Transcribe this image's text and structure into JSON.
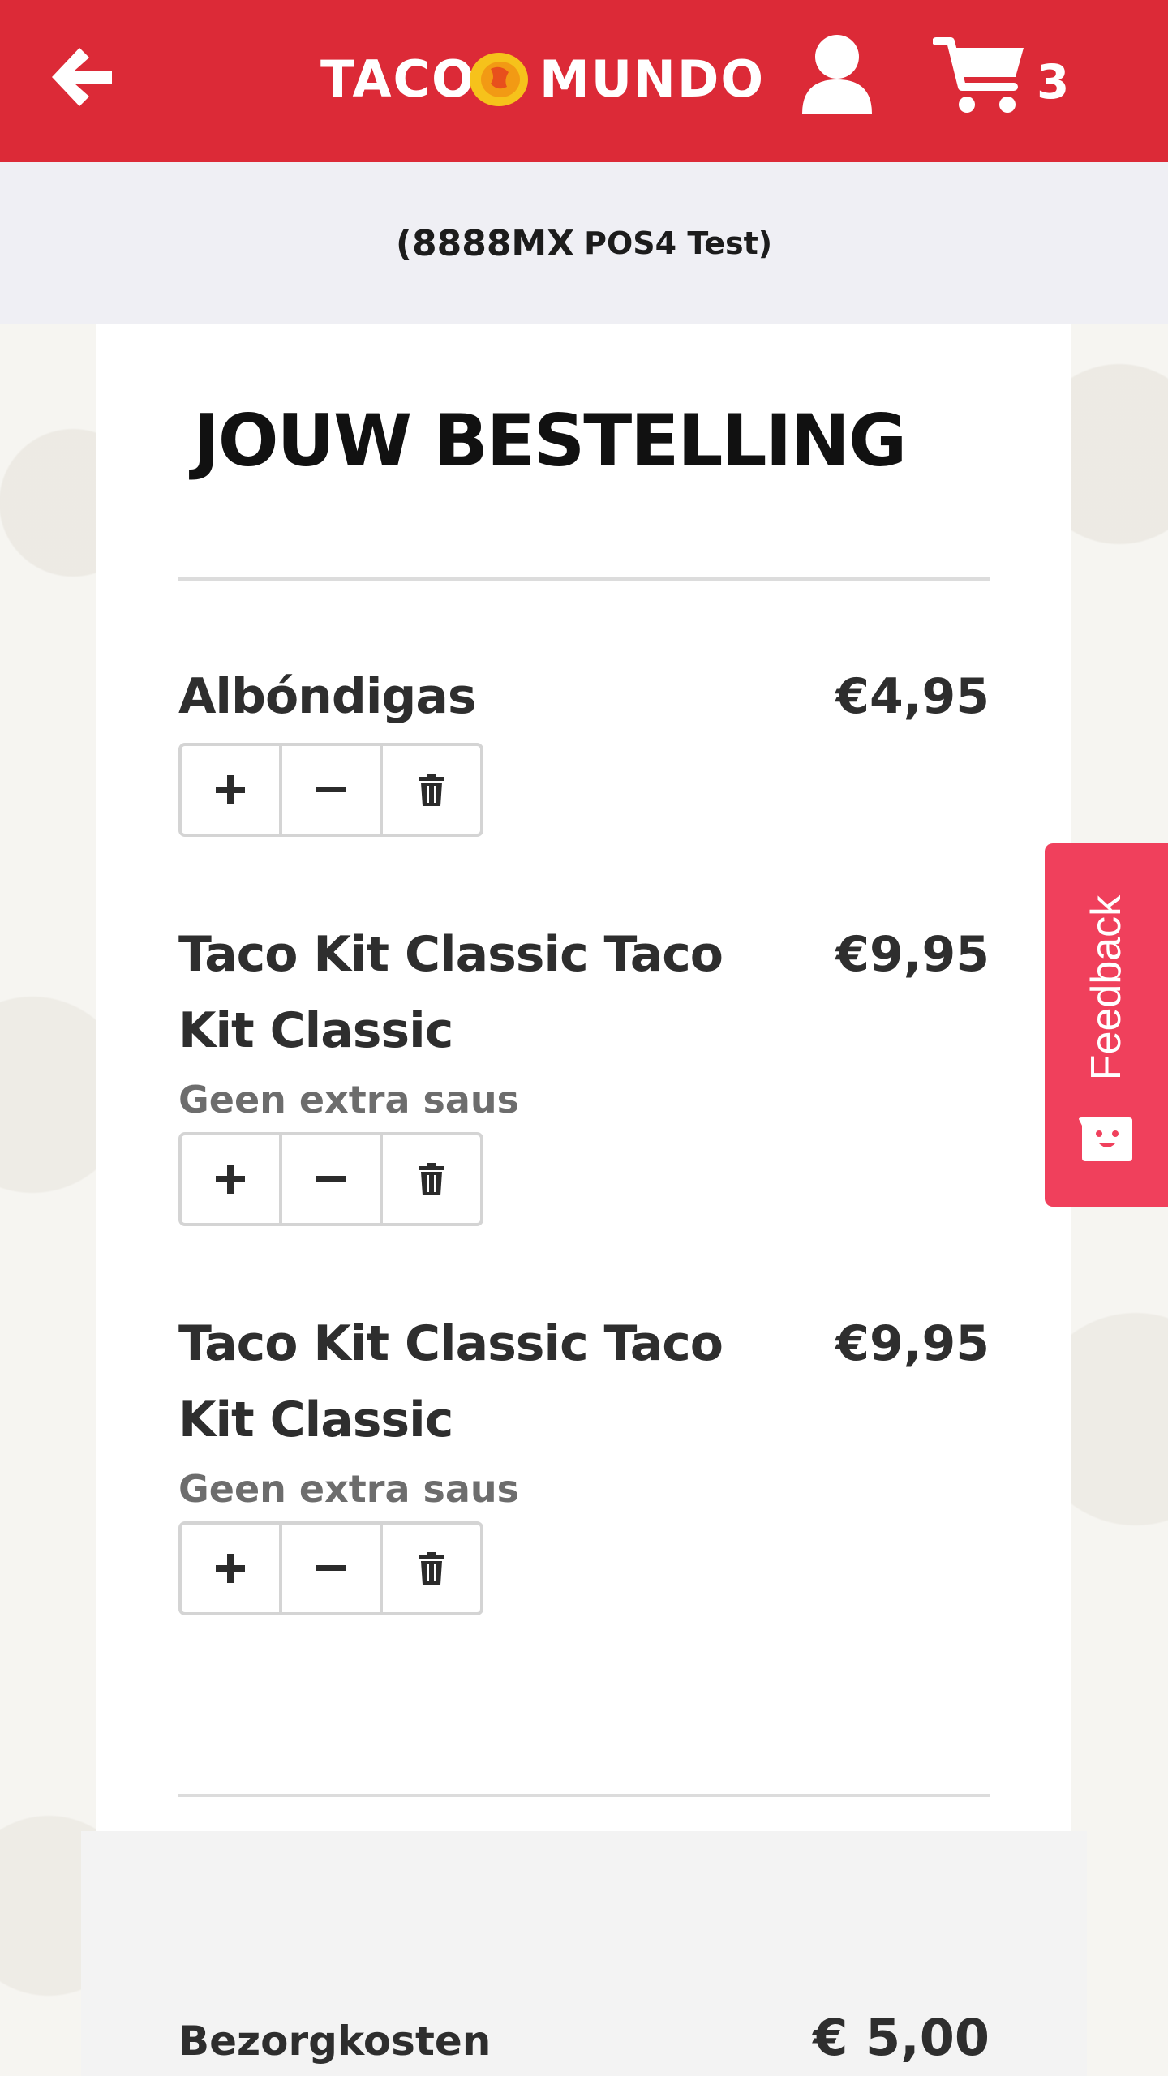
{
  "header": {
    "logo_left": "TACO",
    "logo_right": "MUNDO",
    "cart_count": "3",
    "brand_color": "#dc2a37"
  },
  "location": {
    "postal": "(8888MX",
    "store": "POS4 Test)"
  },
  "order": {
    "title": "JOUW BESTELLING",
    "items": [
      {
        "name": "Albóndigas",
        "price": "€4,95",
        "option": ""
      },
      {
        "name": "Taco Kit Classic Taco Kit Classic",
        "price": "€9,95",
        "option": "Geen extra saus"
      },
      {
        "name": "Taco Kit Classic Taco Kit Classic",
        "price": "€9,95",
        "option": "Geen extra saus"
      }
    ]
  },
  "totals": {
    "delivery_label": "Bezorgkosten",
    "delivery_value": "€ 5,00"
  },
  "feedback": {
    "label": "Feedback",
    "color": "#f0405c"
  },
  "icons": {
    "back": "arrow-left-icon",
    "user": "user-icon",
    "cart": "cart-icon",
    "plus": "plus-icon",
    "minus": "minus-icon",
    "delete": "trash-icon",
    "feedback": "smiley-icon"
  }
}
